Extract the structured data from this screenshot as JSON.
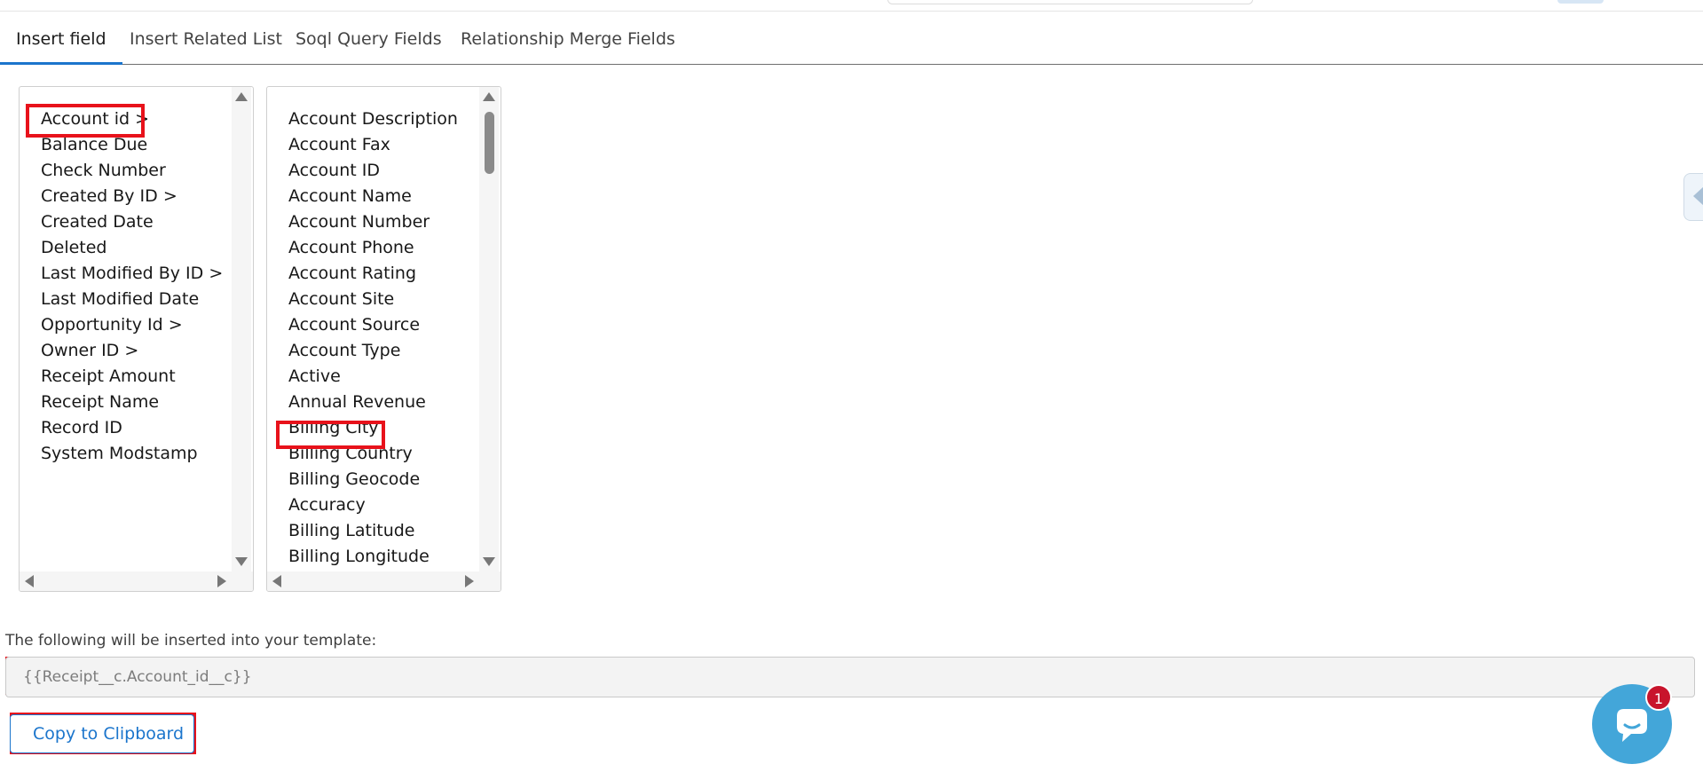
{
  "tabs": [
    {
      "label": "Insert field",
      "active": true
    },
    {
      "label": "Insert Related List",
      "active": false
    },
    {
      "label": "Soql Query Fields",
      "active": false
    },
    {
      "label": "Relationship Merge Fields",
      "active": false
    }
  ],
  "left_list": {
    "items": [
      "Account id >",
      "Balance Due",
      "Check Number",
      "Created By ID >",
      "Created Date",
      "Deleted",
      "Last Modified By ID >",
      "Last Modified Date",
      "Opportunity Id >",
      "Owner ID >",
      "Receipt Amount",
      "Receipt Name",
      "Record ID",
      "System Modstamp"
    ],
    "selected": "Account id >"
  },
  "right_list": {
    "items": [
      "Account Description",
      "Account Fax",
      "Account ID",
      "Account Name",
      "Account Number",
      "Account Phone",
      "Account Rating",
      "Account Site",
      "Account Source",
      "Account Type",
      "Active",
      "Annual Revenue",
      "Billing City",
      "Billing Country",
      "Billing Geocode",
      "Accuracy",
      "Billing Latitude",
      "Billing Longitude"
    ],
    "selected": "Billing City"
  },
  "insert": {
    "label": "The following will be inserted into your template:",
    "value": "{{Receipt__c.Account_id__c}}"
  },
  "copy_button": {
    "label": "Copy to Clipboard"
  },
  "chat": {
    "badge_count": "1"
  },
  "colors": {
    "accent": "#1b75cc",
    "highlight": "#e8121b",
    "chat": "#43a6d9",
    "badge": "#c8142c"
  },
  "icons": {
    "scroll_up": "triangle-up",
    "scroll_down": "triangle-down",
    "scroll_left": "triangle-left",
    "scroll_right": "triangle-right",
    "side_panel": "chevron-left",
    "chat": "chat-bubble"
  }
}
